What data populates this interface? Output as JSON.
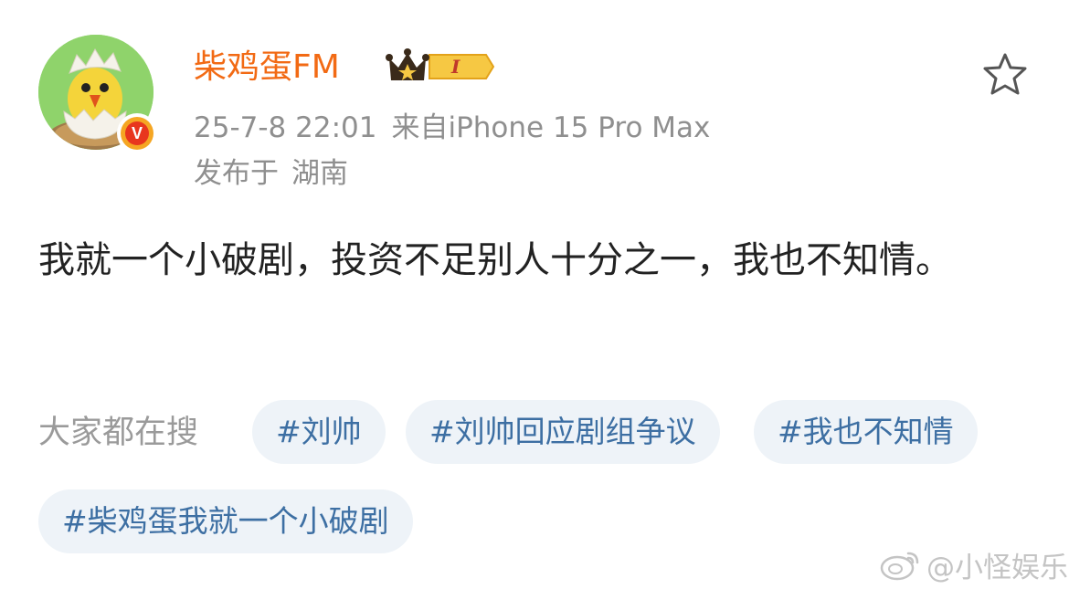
{
  "post": {
    "author": {
      "name": "柴鸡蛋FM",
      "verified_badge": "V",
      "vip_level": "I",
      "avatar_icon": "chick-in-eggshell-avatar"
    },
    "meta": {
      "time": "25-7-8 22:01",
      "source": "来自iPhone 15 Pro Max",
      "location_prefix": "发布于",
      "location": "湖南"
    },
    "content": "我就一个小破剧，投资不足别人十分之一，我也不知情。",
    "favorite_icon": "star-outline-icon"
  },
  "search": {
    "label": "大家都在搜",
    "chips": [
      "#刘帅",
      "#刘帅回应剧组争议",
      "#我也不知情",
      "#柴鸡蛋我就一个小破剧"
    ]
  },
  "watermark": {
    "text": "@小怪娱乐",
    "icon": "weibo-logo-icon"
  },
  "colors": {
    "username": "#f26a14",
    "meta": "#8f8f8f",
    "chip_bg": "#eef3f8",
    "chip_text": "#3d6fa3",
    "body_text": "#222222"
  }
}
